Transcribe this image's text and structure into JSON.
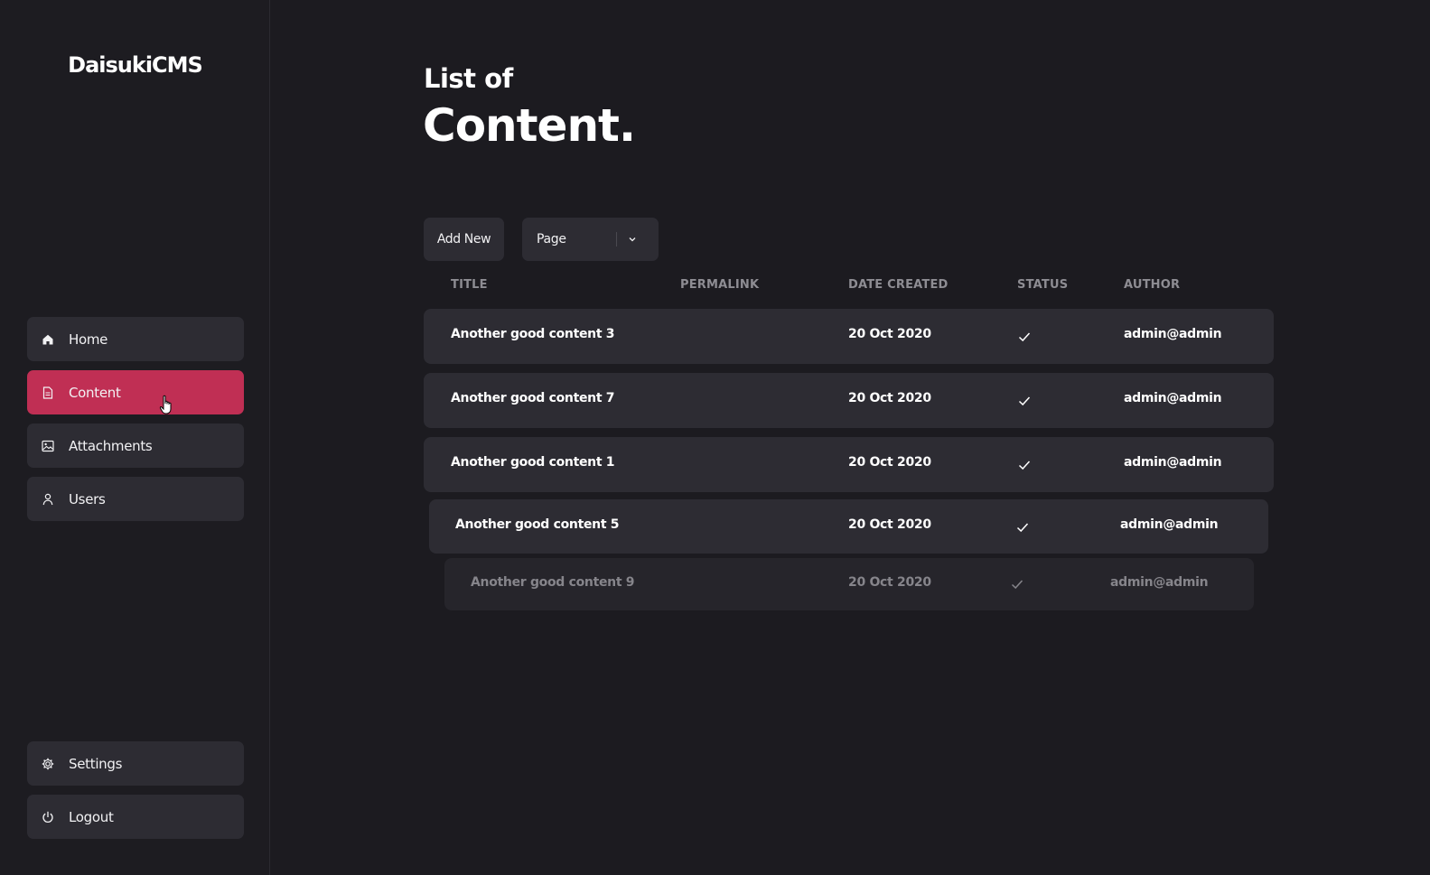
{
  "app": {
    "name": "DaisukiCMS"
  },
  "sidebar": {
    "items": [
      {
        "label": "Home",
        "icon": "home-icon"
      },
      {
        "label": "Content",
        "icon": "document-icon",
        "active": true
      },
      {
        "label": "Attachments",
        "icon": "image-icon"
      },
      {
        "label": "Users",
        "icon": "user-icon"
      }
    ],
    "bottom_items": [
      {
        "label": "Settings",
        "icon": "gear-icon"
      },
      {
        "label": "Logout",
        "icon": "power-icon"
      }
    ]
  },
  "main": {
    "heading_small": "List of",
    "heading_large": "Content.",
    "toolbar": {
      "add_new_label": "Add New",
      "type_select_value": "Page"
    },
    "table": {
      "columns": [
        "TITLE",
        "PERMALINK",
        "DATE CREATED",
        "STATUS",
        "AUTHOR"
      ],
      "rows": [
        {
          "title": "Another good content 3",
          "permalink": "",
          "date": "20 Oct 2020",
          "status": "published",
          "author": "admin@admin"
        },
        {
          "title": "Another good content 7",
          "permalink": "",
          "date": "20 Oct 2020",
          "status": "published",
          "author": "admin@admin"
        },
        {
          "title": "Another good content 1",
          "permalink": "",
          "date": "20 Oct 2020",
          "status": "published",
          "author": "admin@admin"
        },
        {
          "title": "Another good content 5",
          "permalink": "",
          "date": "20 Oct 2020",
          "status": "published",
          "author": "admin@admin"
        },
        {
          "title": "Another good content 9",
          "permalink": "",
          "date": "20 Oct 2020",
          "status": "published",
          "author": "admin@admin"
        }
      ]
    }
  },
  "colors": {
    "background": "#1c1b20",
    "surface": "#2d2c33",
    "accent": "#c02f54",
    "muted_text": "#8e8d93"
  }
}
